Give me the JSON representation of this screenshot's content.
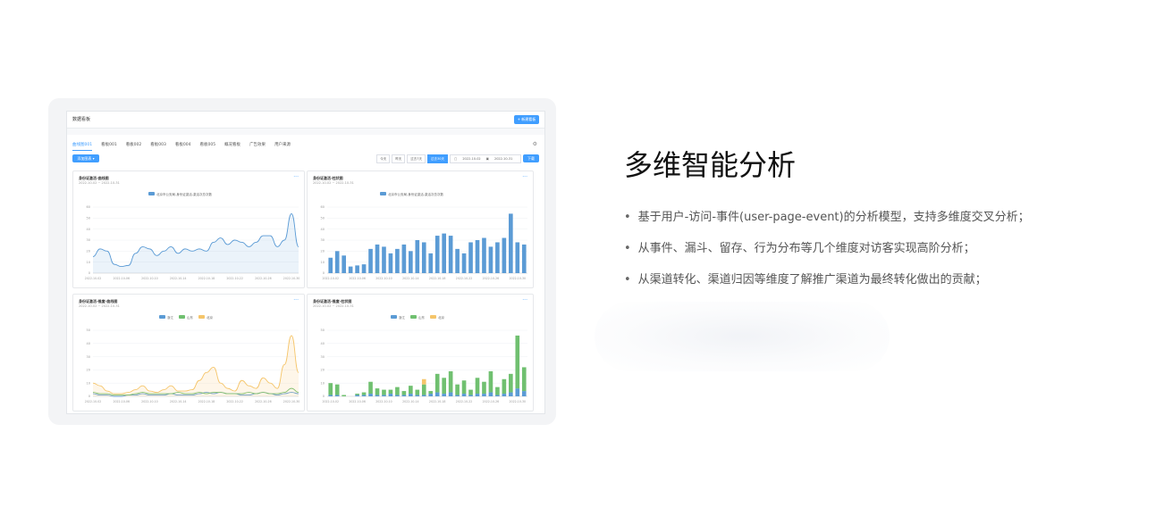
{
  "app": {
    "title": "数据看板",
    "new_button": "+ 新建看板",
    "tabs": [
      "曲线图001",
      "看板001",
      "看板002",
      "看板003",
      "看板004",
      "看板005",
      "概况看板",
      "广告效果",
      "用户来源"
    ],
    "add_button": "添加图表 ▾",
    "filters": [
      "今天",
      "昨天",
      "过去7天",
      "过去30天"
    ],
    "active_filter": "过去30天",
    "date_start": "2022-10-02",
    "date_end": "2022-10-31",
    "download_button": "下载"
  },
  "chart_data": [
    {
      "type": "area",
      "title": "身份证激活-曲线图",
      "subtitle": "2022-10-02 ~ 2022-10-31",
      "series": [
        {
          "name": "北京市公安局-身份证激活-激活次总次数",
          "values": [
            15,
            22,
            20,
            8,
            6,
            7,
            18,
            24,
            22,
            16,
            20,
            24,
            18,
            22,
            20,
            22,
            20,
            28,
            32,
            26,
            30,
            28,
            24,
            28,
            34,
            34,
            24,
            30,
            54,
            24
          ]
        }
      ],
      "x_ticks": [
        "2022-10-02",
        "2022-10-06",
        "2022-10-10",
        "2022-10-14",
        "2022-10-18",
        "2022-10-22",
        "2022-10-26",
        "2022-10-30"
      ],
      "ylim": [
        0,
        60
      ],
      "y_ticks": [
        "0",
        "10",
        "20",
        "30",
        "40",
        "50",
        "60"
      ],
      "color": "#5b9bd5"
    },
    {
      "type": "bar",
      "title": "身份证激活-柱状图",
      "subtitle": "2022-10-02 ~ 2022-10-31",
      "series": [
        {
          "name": "北京市公安局-身份证激活-激活次总次数",
          "values": [
            14,
            20,
            16,
            6,
            7,
            8,
            22,
            26,
            24,
            18,
            22,
            26,
            20,
            30,
            28,
            18,
            34,
            36,
            34,
            22,
            18,
            28,
            30,
            32,
            24,
            28,
            32,
            54,
            28,
            26
          ]
        }
      ],
      "x_ticks": [
        "2022-10-02",
        "2022-10-06",
        "2022-10-10",
        "2022-10-14",
        "2022-10-18",
        "2022-10-22",
        "2022-10-26",
        "2022-10-30"
      ],
      "ylim": [
        0,
        60
      ],
      "y_ticks": [
        "0",
        "10",
        "20",
        "30",
        "40",
        "50",
        "60"
      ],
      "color": "#5b9bd5"
    },
    {
      "type": "line",
      "title": "身份证激活-维度-曲线图",
      "subtitle": "2022-10-02 ~ 2022-10-31",
      "series": [
        {
          "name": "浙江",
          "color": "#5b9bd5",
          "values": [
            2,
            1,
            1,
            0,
            0,
            1,
            1,
            2,
            1,
            1,
            1,
            2,
            1,
            1,
            1,
            2,
            3,
            2,
            3,
            2,
            2,
            1,
            1,
            2,
            3,
            2,
            1,
            2,
            3,
            2
          ]
        },
        {
          "name": "山东",
          "color": "#70c070",
          "values": [
            3,
            2,
            2,
            1,
            1,
            1,
            2,
            3,
            2,
            2,
            2,
            2,
            3,
            2,
            2,
            3,
            2,
            3,
            3,
            2,
            2,
            2,
            3,
            2,
            3,
            2,
            2,
            3,
            6,
            3
          ]
        },
        {
          "name": "北京",
          "color": "#f5c56a",
          "values": [
            10,
            8,
            4,
            2,
            2,
            3,
            5,
            8,
            4,
            3,
            5,
            8,
            4,
            4,
            5,
            12,
            18,
            22,
            10,
            6,
            4,
            12,
            8,
            6,
            14,
            10,
            6,
            24,
            46,
            18
          ]
        }
      ],
      "x_ticks": [
        "2022-10-02",
        "2022-10-06",
        "2022-10-10",
        "2022-10-14",
        "2022-10-18",
        "2022-10-22",
        "2022-10-26",
        "2022-10-30"
      ],
      "ylim": [
        0,
        50
      ],
      "y_ticks": [
        "0",
        "10",
        "20",
        "30",
        "40",
        "50"
      ]
    },
    {
      "type": "bar",
      "stacked": true,
      "title": "身份证激活-维度-柱状图",
      "subtitle": "2022-10-02 ~ 2022-10-31",
      "series": [
        {
          "name": "浙江",
          "color": "#5b9bd5",
          "values": [
            1,
            1,
            0,
            0,
            1,
            1,
            2,
            1,
            1,
            2,
            1,
            1,
            2,
            1,
            1,
            2,
            3,
            2,
            3,
            1,
            2,
            1,
            2,
            2,
            3,
            1,
            2,
            3,
            6,
            4
          ]
        },
        {
          "name": "山东",
          "color": "#70c070",
          "values": [
            9,
            8,
            1,
            0,
            1,
            2,
            9,
            5,
            4,
            3,
            6,
            3,
            6,
            4,
            8,
            2,
            14,
            12,
            16,
            8,
            10,
            4,
            12,
            9,
            16,
            6,
            11,
            14,
            40,
            18
          ]
        },
        {
          "name": "北京",
          "color": "#f5c56a",
          "values": [
            0,
            0,
            0,
            0,
            0,
            0,
            0,
            0,
            0,
            0,
            0,
            0,
            0,
            0,
            4,
            0,
            0,
            0,
            0,
            0,
            0,
            0,
            0,
            0,
            0,
            0,
            0,
            0,
            0,
            0
          ]
        }
      ],
      "x_ticks": [
        "2022-10-02",
        "2022-10-06",
        "2022-10-10",
        "2022-10-14",
        "2022-10-18",
        "2022-10-22",
        "2022-10-26",
        "2022-10-30"
      ],
      "ylim": [
        0,
        50
      ],
      "y_ticks": [
        "0",
        "10",
        "20",
        "30",
        "40",
        "50"
      ]
    }
  ],
  "feature": {
    "title": "多维智能分析",
    "bullets": [
      "基于用户-访问-事件(user-page-event)的分析模型，支持多维度交叉分析；",
      "从事件、漏斗、留存、行为分布等几个维度对访客实现高阶分析；",
      "从渠道转化、渠道归因等维度了解推广渠道为最终转化做出的贡献；"
    ]
  }
}
